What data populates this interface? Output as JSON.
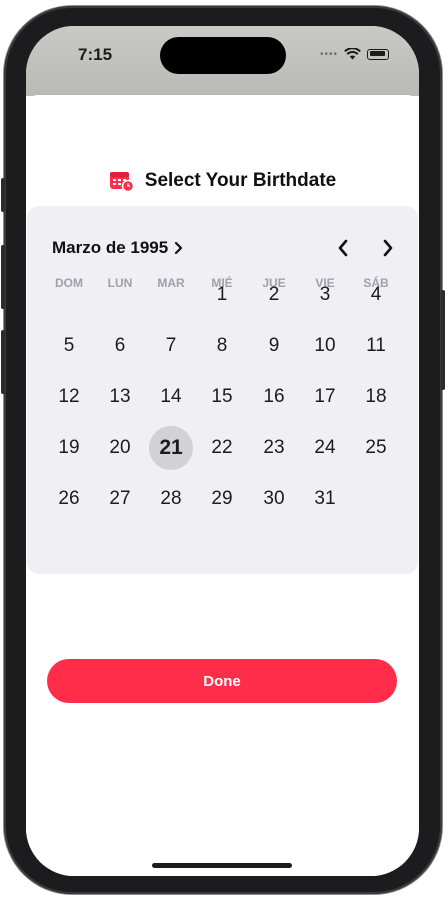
{
  "status_bar": {
    "time": "7:15"
  },
  "header": {
    "title": "Select Your Birthdate"
  },
  "calendar": {
    "month_label": "Marzo de 1995",
    "weekdays": [
      "DOM",
      "LUN",
      "MAR",
      "MIÉ",
      "JUE",
      "VIE",
      "SÁB"
    ],
    "first_weekday_index": 3,
    "days_in_month": 31,
    "selected_day": 21,
    "days": [
      "1",
      "2",
      "3",
      "4",
      "5",
      "6",
      "7",
      "8",
      "9",
      "10",
      "11",
      "12",
      "13",
      "14",
      "15",
      "16",
      "17",
      "18",
      "19",
      "20",
      "21",
      "22",
      "23",
      "24",
      "25",
      "26",
      "27",
      "28",
      "29",
      "30",
      "31"
    ]
  },
  "done_button": {
    "label": "Done"
  },
  "colors": {
    "accent": "#ff2d4a",
    "panel": "#f0eff4",
    "selected": "#d1d1d6"
  },
  "icons": {
    "title_icon": "calendar-badge-icon",
    "month_chevron": "chevron-right-icon",
    "prev": "chevron-left-icon",
    "next": "chevron-right-icon"
  }
}
